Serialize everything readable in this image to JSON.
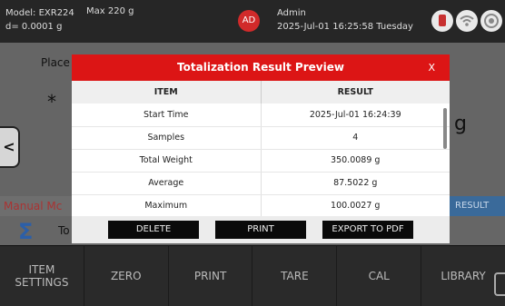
{
  "status": {
    "model": "Model: EXR224",
    "max": "Max 220 g",
    "resolution": "d= 0.0001 g",
    "avatar": "AD",
    "user": "Admin",
    "datetime": "2025-Jul-01 16:25:58 Tuesday"
  },
  "background": {
    "place_text": "Place",
    "star": "*",
    "unit": "g",
    "side_arrow": "<",
    "manual_text": "Manual Mc",
    "result_tab": "RESULT",
    "sigma": "Σ",
    "to_text": "To"
  },
  "modal": {
    "title": "Totalization Result Preview",
    "close": "X",
    "headers": [
      "ITEM",
      "RESULT"
    ],
    "rows": [
      {
        "item": "Start Time",
        "result": "2025-Jul-01 16:24:39"
      },
      {
        "item": "Samples",
        "result": "4"
      },
      {
        "item": "Total Weight",
        "result": "350.0089 g"
      },
      {
        "item": "Average",
        "result": "87.5022 g"
      },
      {
        "item": "Maximum",
        "result": "100.0027 g"
      }
    ],
    "buttons": {
      "delete": "DELETE",
      "print": "PRINT",
      "export": "EXPORT TO PDF"
    }
  },
  "bottombar": {
    "item_settings": "ITEM\nSETTINGS",
    "zero": "ZERO",
    "print": "PRINT",
    "tare": "TARE",
    "cal": "CAL",
    "library": "LIBRARY"
  },
  "icons": [
    "usb-icon",
    "wifi-icon",
    "target-icon",
    "chevron-left-icon",
    "sigma-icon"
  ]
}
